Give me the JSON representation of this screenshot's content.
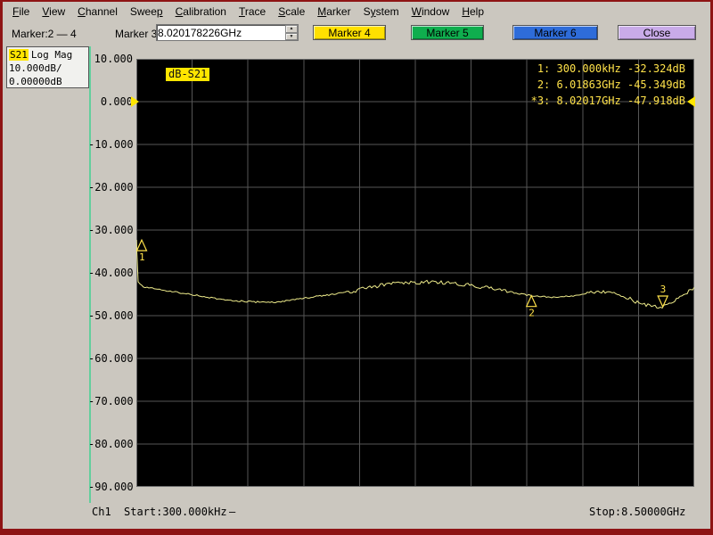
{
  "window": {
    "border_color": "#8e1414",
    "chrome_bg": "#cbc7bf"
  },
  "menu": {
    "items": [
      {
        "label": "File",
        "u": 0
      },
      {
        "label": "View",
        "u": 0
      },
      {
        "label": "Channel",
        "u": 0
      },
      {
        "label": "Sweep",
        "u": 4
      },
      {
        "label": "Calibration",
        "u": 0
      },
      {
        "label": "Trace",
        "u": 0
      },
      {
        "label": "Scale",
        "u": 0
      },
      {
        "label": "Marker",
        "u": 0
      },
      {
        "label": "System",
        "u": 1
      },
      {
        "label": "Window",
        "u": 0
      },
      {
        "label": "Help",
        "u": 0
      }
    ]
  },
  "toolbar": {
    "marker_range_label": "Marker:2 — 4",
    "marker3_label": "Marker 3",
    "marker3_value": "8.020178226GHz",
    "buttons": [
      {
        "label": "Marker 4",
        "color": "#ffe000"
      },
      {
        "label": "Marker 5",
        "color": "#0fae4e"
      },
      {
        "label": "Marker 6",
        "color": "#2e6cd9"
      },
      {
        "label": "Close",
        "color": "#c9abe9"
      }
    ]
  },
  "trace_panel": {
    "trace": "S21",
    "format": "Log Mag",
    "scale": "10.000dB/",
    "ref": "0.00000dB",
    "highlight": "#ffe600"
  },
  "plot": {
    "format_chip": "dB-S21",
    "y_ticks": [
      "10.000",
      "0.000",
      "-10.000",
      "-20.000",
      "-30.000",
      "-40.000",
      "-50.000",
      "-60.000",
      "-70.000",
      "-80.000",
      "-90.000"
    ],
    "marker_readouts": [
      "1: 300.000kHz -32.324dB",
      "2: 6.01863GHz -45.349dB",
      "*3: 8.02017GHz -47.918dB"
    ],
    "trace_color": "#efec8b",
    "grid_color": "#565656",
    "marker_color": "#ffe24a",
    "reference_color": "#ffe600",
    "reference_level_db": 0
  },
  "status": {
    "channel": "Ch1",
    "start": "Start:300.000kHz",
    "sweep_indicator": "—",
    "stop": "Stop:8.50000GHz"
  },
  "chart_data": {
    "type": "line",
    "title": "dB-S21",
    "xlabel": "",
    "ylabel": "dB",
    "x_range_ghz": [
      0.0003,
      8.5
    ],
    "ylim": [
      -90,
      10
    ],
    "y_tick_step": 10,
    "grid": true,
    "series": [
      {
        "name": "S21 Log Mag",
        "x_ghz": [
          0.0003,
          0.02,
          0.1,
          0.3,
          0.6,
          0.9,
          1.2,
          1.5,
          1.8,
          2.1,
          2.4,
          2.7,
          3.0,
          3.3,
          3.6,
          3.9,
          4.2,
          4.5,
          4.8,
          5.1,
          5.4,
          5.7,
          6.02,
          6.3,
          6.6,
          6.9,
          7.1,
          7.3,
          7.5,
          7.7,
          7.9,
          8.02,
          8.15,
          8.3,
          8.5
        ],
        "y_db": [
          -32.3,
          -42.0,
          -43.2,
          -43.8,
          -44.5,
          -45.2,
          -46.0,
          -46.5,
          -46.8,
          -46.9,
          -46.3,
          -45.6,
          -45.0,
          -44.3,
          -43.2,
          -42.6,
          -42.3,
          -42.1,
          -42.4,
          -42.9,
          -43.6,
          -44.5,
          -45.35,
          -45.7,
          -45.5,
          -44.6,
          -44.4,
          -44.9,
          -46.0,
          -47.3,
          -47.8,
          -47.92,
          -46.8,
          -45.5,
          -43.6
        ]
      }
    ],
    "markers": [
      {
        "n": "1",
        "x_ghz": 0.0003,
        "y_db": -32.324,
        "shape": "up",
        "active": false
      },
      {
        "n": "2",
        "x_ghz": 6.01863,
        "y_db": -45.349,
        "shape": "up",
        "active": false
      },
      {
        "n": "3",
        "x_ghz": 8.02017,
        "y_db": -47.918,
        "shape": "down",
        "active": true
      }
    ]
  }
}
